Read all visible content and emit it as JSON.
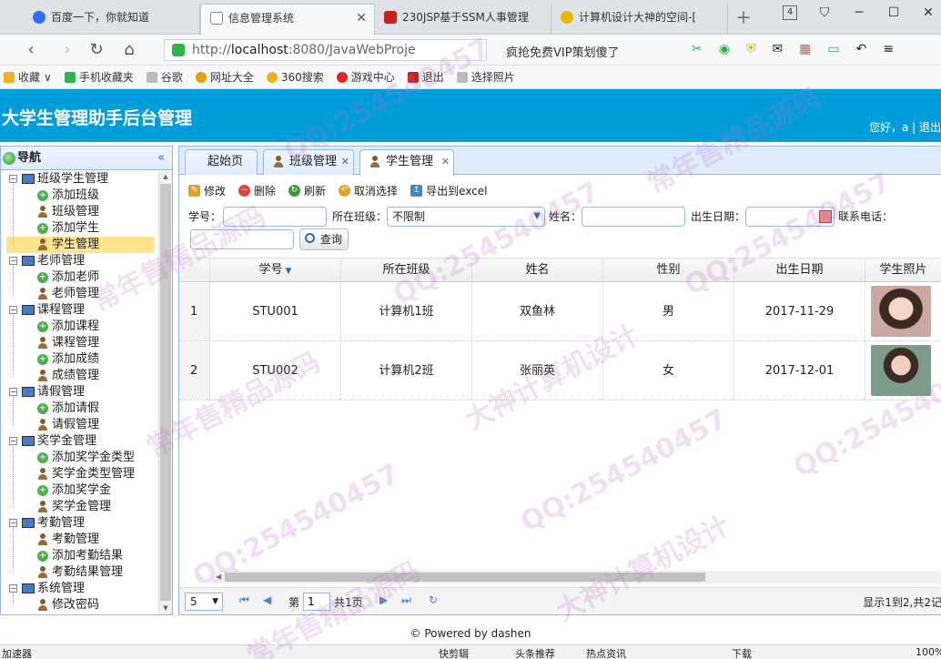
{
  "browser": {
    "tabs": [
      {
        "title": "百度一下，你就知道",
        "icon_color": "#2f6ff0"
      },
      {
        "title": "信息管理系统",
        "icon_color": "#9aa0a6"
      },
      {
        "title": "230JSP基于SSM人事管理",
        "icon_color": "#c8201e"
      },
      {
        "title": "计算机设计大神的空间-[",
        "icon_color": "#e6b800"
      }
    ],
    "tab_count": "4",
    "url_prefix": "http://",
    "url_host": "localhost",
    "url_rest": ":8080/JavaWebProje",
    "promo_text": "疯抢免费VIP策划傻了",
    "bookmarks": [
      {
        "label": "收藏",
        "icon_color": "#f2b01e"
      },
      {
        "label": "手机收藏夹",
        "icon_color": "#2fb44a"
      },
      {
        "label": "谷歌",
        "icon_color": "#bbbbbb"
      },
      {
        "label": "网址大全",
        "icon_color": "#e6a100"
      },
      {
        "label": "360搜索",
        "icon_color": "#f2b01e"
      },
      {
        "label": "游戏中心",
        "icon_color": "#d92a2a"
      },
      {
        "label": "退出",
        "icon_color": "#c8201e"
      },
      {
        "label": "选择照片",
        "icon_color": "#bbbbbb"
      }
    ]
  },
  "app": {
    "title": "大学生管理助手后台管理",
    "user_info": "您好，a | 退出",
    "header_color": "#009ddb"
  },
  "sidebar": {
    "title": "导航",
    "collapse_glyph": "«",
    "groups": [
      {
        "label": "班级学生管理",
        "items": [
          "添加班级",
          "班级管理",
          "添加学生",
          "学生管理"
        ]
      },
      {
        "label": "老师管理",
        "items": [
          "添加老师",
          "老师管理"
        ]
      },
      {
        "label": "课程管理",
        "items": [
          "添加课程",
          "课程管理",
          "添加成绩",
          "成绩管理"
        ]
      },
      {
        "label": "请假管理",
        "items": [
          "添加请假",
          "请假管理"
        ]
      },
      {
        "label": "奖学金管理",
        "items": [
          "添加奖学金类型",
          "奖学金类型管理",
          "添加奖学金",
          "奖学金管理"
        ]
      },
      {
        "label": "考勤管理",
        "items": [
          "考勤管理",
          "添加考勤结果",
          "考勤结果管理"
        ]
      },
      {
        "label": "系统管理",
        "items": [
          "修改密码"
        ]
      }
    ],
    "selected": "学生管理"
  },
  "panel_tabs": [
    {
      "label": "起始页",
      "closable": false
    },
    {
      "label": "班级管理",
      "closable": true
    },
    {
      "label": "学生管理",
      "closable": true
    }
  ],
  "toolbar": {
    "edit": "修改",
    "delete": "删除",
    "refresh": "刷新",
    "cancel_select": "取消选择",
    "export": "导出到excel"
  },
  "search": {
    "student_no_label": "学号：",
    "class_label": "所在班级：",
    "class_value": "不限制",
    "name_label": "姓名：",
    "birth_label": "出生日期：",
    "phone_label": "联系电话：",
    "query_button": "查询"
  },
  "grid": {
    "columns": [
      "学号",
      "所在班级",
      "姓名",
      "性别",
      "出生日期",
      "学生照片"
    ],
    "rows": [
      {
        "num": "1",
        "no": "STU001",
        "class": "计算机1班",
        "name": "双鱼林",
        "gender": "男",
        "birth": "2017-11-29"
      },
      {
        "num": "2",
        "no": "STU002",
        "class": "计算机2班",
        "name": "张丽英",
        "gender": "女",
        "birth": "2017-12-01"
      }
    ]
  },
  "pager": {
    "page_size": "5",
    "page_prefix": "第",
    "page_value": "1",
    "page_suffix": "共1页",
    "info": "显示1到2,共2记"
  },
  "footer": "© Powered by dashen",
  "statusbar": {
    "left": "加速器",
    "items": [
      "快剪辑",
      "头条推荐",
      "热点资讯",
      "下载",
      "100%"
    ]
  },
  "watermarks": [
    "QQ:254540457",
    "常年售精品源码",
    "大神计算机设计"
  ]
}
